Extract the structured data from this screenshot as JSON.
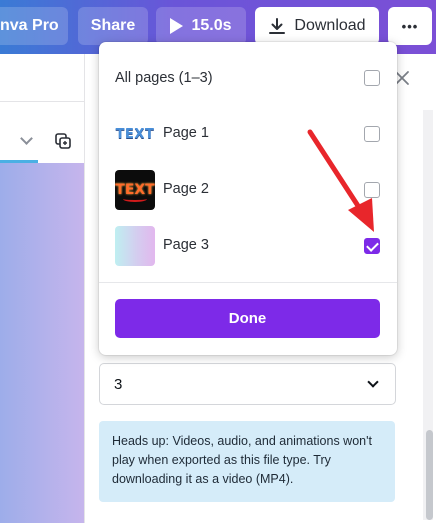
{
  "toolbar": {
    "pro_label": "nva Pro",
    "share_label": "Share",
    "play_label": "15.0s",
    "download_label": "Download",
    "more_label": "•••"
  },
  "page_select": {
    "all_pages_label": "All pages (1–3)",
    "pages": [
      {
        "label": "Page 1",
        "thumb_text": "TEXT",
        "checked": false
      },
      {
        "label": "Page 2",
        "thumb_text": "TEXT",
        "checked": false
      },
      {
        "label": "Page 3",
        "thumb_text": "",
        "checked": true
      }
    ],
    "done_label": "Done"
  },
  "quality_select": {
    "value": "3"
  },
  "notice": {
    "text": "Heads up: Videos, audio, and animations won't play when exported as this file type. Try downloading it as a video (MP4)."
  },
  "colors": {
    "accent": "#7d2ae8",
    "notice_bg": "#d5ecf9",
    "annotation_arrow": "#e8262b"
  }
}
